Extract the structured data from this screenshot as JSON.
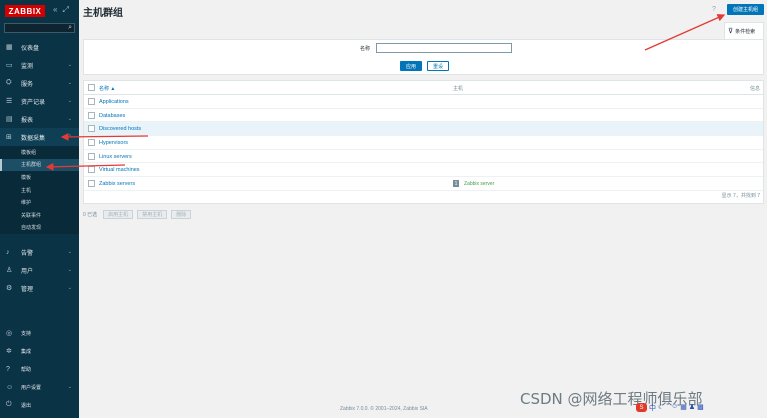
{
  "app": {
    "logo": "ZABBIX",
    "collapse_icon": "«",
    "expand_icon": "⤢"
  },
  "sidebar": {
    "search_placeholder": "",
    "items": [
      {
        "label": "仪表盘",
        "icon": "dashboard-icon",
        "chev": ""
      },
      {
        "label": "监测",
        "icon": "monitoring-icon",
        "chev": "⌄"
      },
      {
        "label": "服务",
        "icon": "services-icon",
        "chev": "⌄"
      },
      {
        "label": "资产记录",
        "icon": "inventory-icon",
        "chev": "⌄"
      },
      {
        "label": "报表",
        "icon": "reports-icon",
        "chev": "⌄"
      },
      {
        "label": "数据采集",
        "icon": "data-collection-icon",
        "chev": "⌃"
      }
    ],
    "sub_items": [
      "模板组",
      "主机群组",
      "模板",
      "主机",
      "维护",
      "关联事件",
      "自动发现"
    ],
    "items2": [
      {
        "label": "告警",
        "icon": "alerts-icon",
        "chev": "⌄"
      },
      {
        "label": "用户",
        "icon": "users-icon",
        "chev": "⌄"
      },
      {
        "label": "管理",
        "icon": "admin-icon",
        "chev": "⌄"
      }
    ],
    "bottom": [
      {
        "label": "支持",
        "icon": "support-icon",
        "chev": ""
      },
      {
        "label": "集成",
        "icon": "integrations-icon",
        "chev": ""
      },
      {
        "label": "帮助",
        "icon": "help-icon",
        "chev": ""
      },
      {
        "label": "用户设置",
        "icon": "user-settings-icon",
        "chev": "⌄"
      },
      {
        "label": "退出",
        "icon": "signout-icon",
        "chev": ""
      }
    ]
  },
  "header": {
    "title": "主机群组",
    "help": "?",
    "create_label": "创建主机组"
  },
  "filter": {
    "tab_label": "条件检索",
    "name_label": "名称",
    "name_value": "",
    "apply": "应用",
    "reset": "重设"
  },
  "table": {
    "col_name": "名称 ▲",
    "col_hosts": "主机",
    "col_info": "信息",
    "rows": [
      {
        "name": "Applications",
        "count": "",
        "host": ""
      },
      {
        "name": "Databases",
        "count": "",
        "host": ""
      },
      {
        "name": "Discovered hosts",
        "count": "",
        "host": ""
      },
      {
        "name": "Hypervisors",
        "count": "",
        "host": ""
      },
      {
        "name": "Linux servers",
        "count": "",
        "host": ""
      },
      {
        "name": "Virtual machines",
        "count": "",
        "host": ""
      },
      {
        "name": "Zabbix servers",
        "count": "1",
        "host": "Zabbix server"
      }
    ],
    "footer": "显示 7，共找到 7"
  },
  "mass": {
    "count": "0 已选",
    "enable": "启用主机",
    "disable": "禁用主机",
    "delete": "删除"
  },
  "footer": "Zabbix 7.0.0. © 2001–2024, Zabbix SIA",
  "watermark": "CSDN @网络工程师俱乐部",
  "colors": {
    "brand": "#d40000",
    "sidebar": "#0b3346",
    "accent": "#0275b8",
    "arrow": "#e53935"
  }
}
